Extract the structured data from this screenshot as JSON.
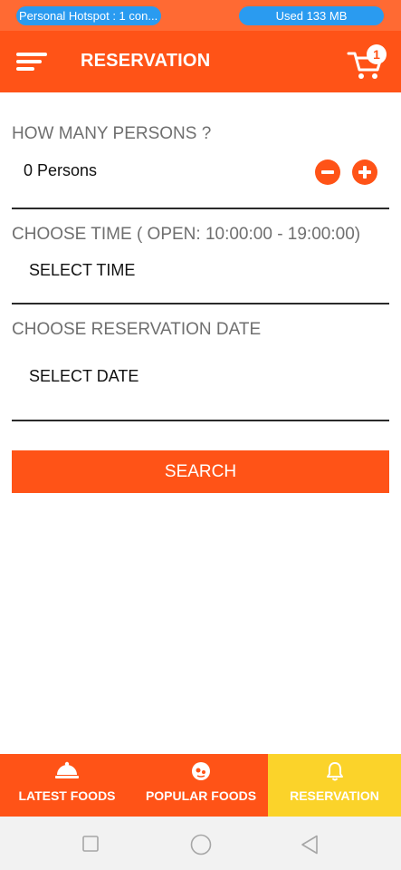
{
  "status_bar": {
    "hotspot_text": "Personal Hotspot : 1 con...",
    "data_used_text": "Used  133 MB"
  },
  "app_bar": {
    "title": "RESERVATION",
    "cart_count": "1",
    "menu_icon": "menu-icon",
    "cart_icon": "shopping-cart-icon"
  },
  "form": {
    "persons_label": "HOW MANY PERSONS ?",
    "persons_value": "0 Persons",
    "time_label": "CHOOSE TIME ( OPEN: 10:00:00 - 19:00:00)",
    "time_value": "SELECT TIME",
    "date_label": "CHOOSE RESERVATION DATE",
    "date_value": "SELECT DATE",
    "search_label": "SEARCH"
  },
  "bottom_nav": {
    "items": [
      {
        "label": "LATEST FOODS",
        "icon": "cloche-icon",
        "active": false
      },
      {
        "label": "POPULAR FOODS",
        "icon": "popular-food-icon",
        "active": false
      },
      {
        "label": "RESERVATION",
        "icon": "bell-icon",
        "active": true
      }
    ]
  },
  "colors": {
    "primary": "#ff5317",
    "status_bar": "#ff6a33",
    "active_tab": "#fbd32a",
    "pill": "#2a9bf0"
  }
}
